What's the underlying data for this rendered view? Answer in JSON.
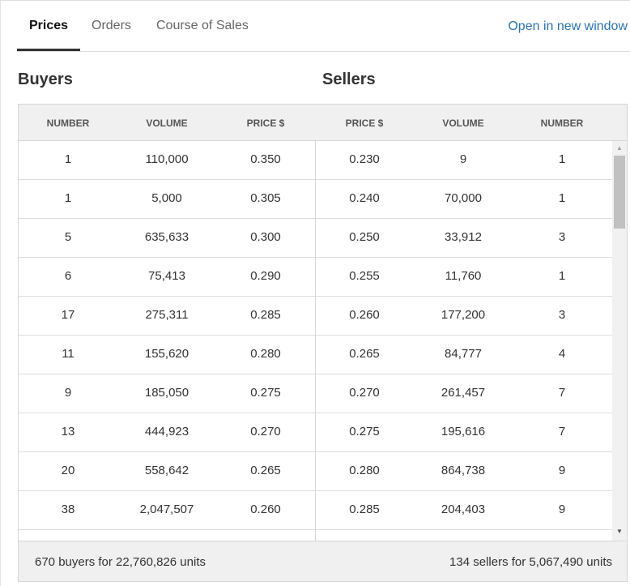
{
  "tabs": [
    {
      "label": "Prices",
      "active": true
    },
    {
      "label": "Orders",
      "active": false
    },
    {
      "label": "Course of Sales",
      "active": false
    }
  ],
  "open_link": "Open in new window",
  "buyers_title": "Buyers",
  "sellers_title": "Sellers",
  "columns": [
    "NUMBER",
    "VOLUME",
    "PRICE $",
    "PRICE $",
    "VOLUME",
    "NUMBER"
  ],
  "rows": [
    {
      "buy_number": "1",
      "buy_volume": "110,000",
      "buy_price": "0.350",
      "sell_price": "0.230",
      "sell_volume": "9",
      "sell_number": "1"
    },
    {
      "buy_number": "1",
      "buy_volume": "5,000",
      "buy_price": "0.305",
      "sell_price": "0.240",
      "sell_volume": "70,000",
      "sell_number": "1"
    },
    {
      "buy_number": "5",
      "buy_volume": "635,633",
      "buy_price": "0.300",
      "sell_price": "0.250",
      "sell_volume": "33,912",
      "sell_number": "3"
    },
    {
      "buy_number": "6",
      "buy_volume": "75,413",
      "buy_price": "0.290",
      "sell_price": "0.255",
      "sell_volume": "11,760",
      "sell_number": "1"
    },
    {
      "buy_number": "17",
      "buy_volume": "275,311",
      "buy_price": "0.285",
      "sell_price": "0.260",
      "sell_volume": "177,200",
      "sell_number": "3"
    },
    {
      "buy_number": "11",
      "buy_volume": "155,620",
      "buy_price": "0.280",
      "sell_price": "0.265",
      "sell_volume": "84,777",
      "sell_number": "4"
    },
    {
      "buy_number": "9",
      "buy_volume": "185,050",
      "buy_price": "0.275",
      "sell_price": "0.270",
      "sell_volume": "261,457",
      "sell_number": "7"
    },
    {
      "buy_number": "13",
      "buy_volume": "444,923",
      "buy_price": "0.270",
      "sell_price": "0.275",
      "sell_volume": "195,616",
      "sell_number": "7"
    },
    {
      "buy_number": "20",
      "buy_volume": "558,642",
      "buy_price": "0.265",
      "sell_price": "0.280",
      "sell_volume": "864,738",
      "sell_number": "9"
    },
    {
      "buy_number": "38",
      "buy_volume": "2,047,507",
      "buy_price": "0.260",
      "sell_price": "0.285",
      "sell_volume": "204,403",
      "sell_number": "9"
    },
    {
      "buy_number": "",
      "buy_volume": "",
      "buy_price": "",
      "sell_price": "",
      "sell_volume": "",
      "sell_number": ""
    }
  ],
  "footer": {
    "buyers_summary": "670 buyers for 22,760,826 units",
    "sellers_summary": "134 sellers for 5,067,490 units"
  },
  "icons": {
    "scroll_up": "up-arrow-icon",
    "scroll_down": "down-arrow-icon"
  },
  "colors": {
    "link": "#2a73b5",
    "header_bg": "#f0f0f0",
    "border": "#d6d6d6"
  }
}
